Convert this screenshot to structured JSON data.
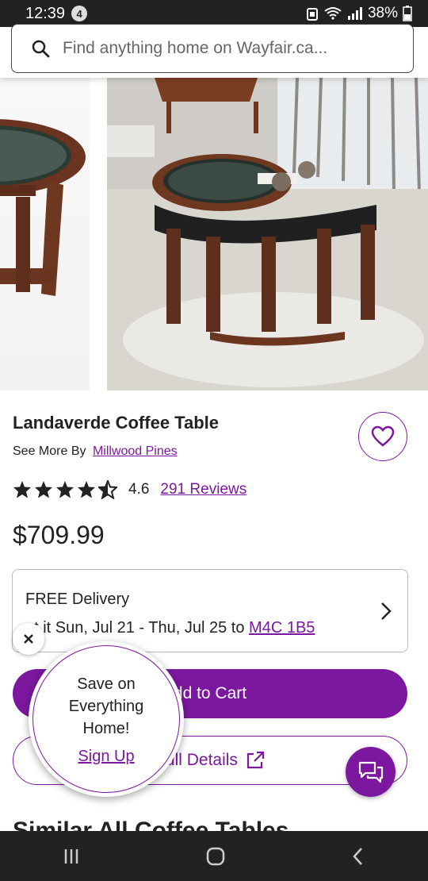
{
  "status_bar": {
    "time": "12:39",
    "notification_count": "4",
    "battery": "38%"
  },
  "search": {
    "placeholder": "Find anything home on Wayfair.ca..."
  },
  "product": {
    "title": "Landaverde Coffee Table",
    "see_more_prefix": "See More By",
    "brand": "Millwood Pines",
    "rating": "4.6",
    "rating_stars": 4.5,
    "reviews_link": "291 Reviews",
    "price": "$709.99"
  },
  "delivery": {
    "title": "FREE Delivery",
    "detail_prefix": "et it Sun, Jul 21 - Thu, Jul 25 to",
    "postal_code": "M4C 1B5"
  },
  "buttons": {
    "add_to_cart": "dd to Cart",
    "full_details": "Full Details"
  },
  "promo": {
    "text": "Save on Everything Home!",
    "link": "Sign Up"
  },
  "section": {
    "similar_heading": "Similar All Coffee Tables"
  },
  "colors": {
    "brand_purple": "#7b189f",
    "status_bar_bg": "#222222"
  },
  "icons": {
    "search": "search-icon",
    "favorite": "heart-icon",
    "chevron": "chevron-right-icon",
    "external": "external-link-icon",
    "chat": "chat-icon",
    "close": "close-icon"
  }
}
